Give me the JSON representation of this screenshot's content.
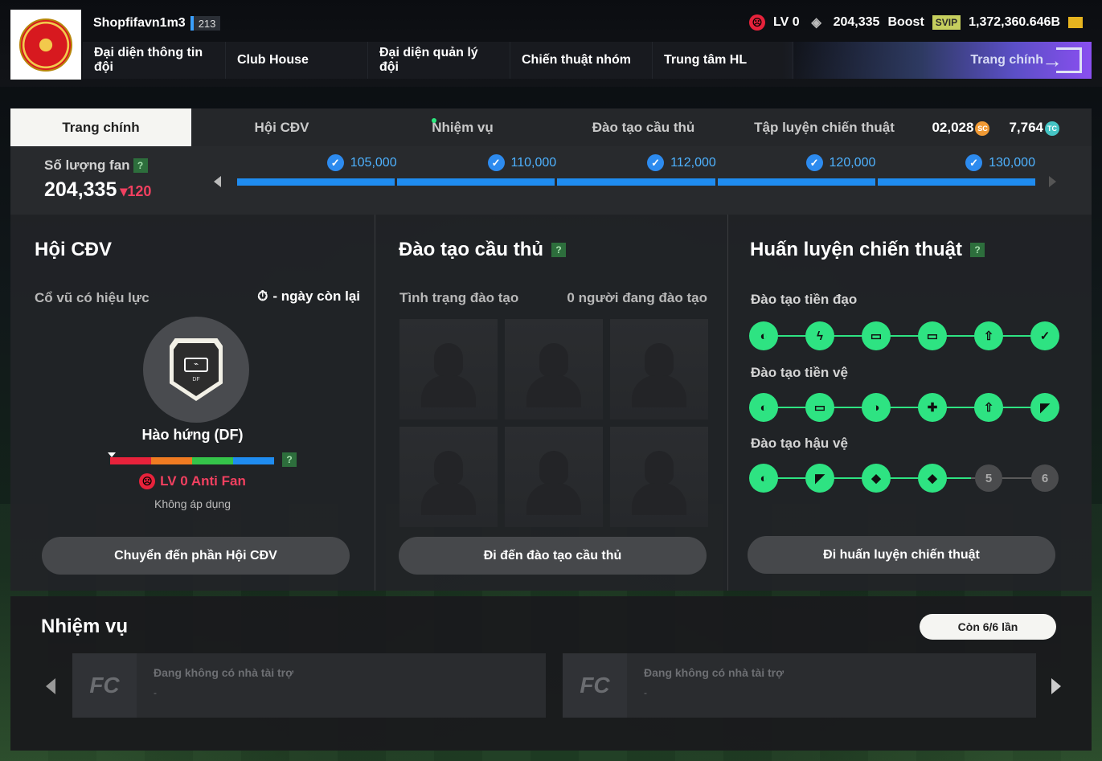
{
  "header": {
    "username": "Shopfifavn1m3",
    "level": "213",
    "fan_level": "LV 0",
    "fans": "204,335",
    "boost_label": "Boost",
    "svip_label": "SVIP",
    "bp": "1,372,360.646B",
    "nav": [
      "Đại diện thông tin đội",
      "Club House",
      "Đại diện quản lý đội",
      "Chiến thuật nhóm",
      "Trung tâm HL"
    ],
    "main_nav_label": "Trang chính"
  },
  "sub_tabs": [
    "Trang chính",
    "Hội CĐV",
    "Nhiệm vụ",
    "Đào tạo cầu thủ",
    "Tập luyện chiến thuật"
  ],
  "currencies": {
    "sc": "02,028",
    "sc_icon": "SC",
    "tc": "7,764",
    "tc_icon": "TC"
  },
  "fan_section": {
    "label": "Số lượng fan",
    "help": "?",
    "count": "204,335",
    "delta": "▾120",
    "milestones": [
      "105,000",
      "110,000",
      "112,000",
      "120,000",
      "130,000"
    ]
  },
  "supporters": {
    "title": "Hội CĐV",
    "active_label": "Cổ vũ có hiệu lực",
    "days_left": "- ngày còn lại",
    "shield_tag": "DF",
    "boost_name": "Hào hứng (DF)",
    "help": "?",
    "level_text": "LV 0 Anti Fan",
    "not_applied": "Không áp dụng",
    "button": "Chuyển đến phần Hội CĐV"
  },
  "player_training": {
    "title": "Đào tạo cầu thủ",
    "help": "?",
    "status_label": "Tình trạng đào tạo",
    "count_label": "0 người đang đào tạo",
    "button": "Đi đến đào tạo cầu thủ"
  },
  "tactic_training": {
    "title": "Huấn luyện chiến thuật",
    "help": "?",
    "tracks": [
      {
        "label": "Đào tạo tiền đạo",
        "nodes": [
          "◐",
          "ϟ",
          "▭",
          "▭",
          "⇧",
          "✓"
        ]
      },
      {
        "label": "Đào tạo tiền vệ",
        "nodes": [
          "◐",
          "▭",
          "◑",
          "✚",
          "⇧",
          "◤"
        ]
      },
      {
        "label": "Đào tạo hậu vệ",
        "nodes": [
          "◐",
          "◤",
          "◆",
          "◆",
          "5",
          "6"
        ]
      }
    ],
    "button": "Đi huấn luyện chiến thuật"
  },
  "missions": {
    "title": "Nhiệm vụ",
    "remaining": "Còn 6/6 lần",
    "cards": [
      {
        "text": "Đang không có nhà tài trợ",
        "sub": "-"
      },
      {
        "text": "Đang không có nhà tài trợ",
        "sub": "-"
      }
    ]
  },
  "colors": {
    "accent_blue": "#1f8cf0",
    "green": "#2ee382",
    "anti_red": "#f24060"
  }
}
